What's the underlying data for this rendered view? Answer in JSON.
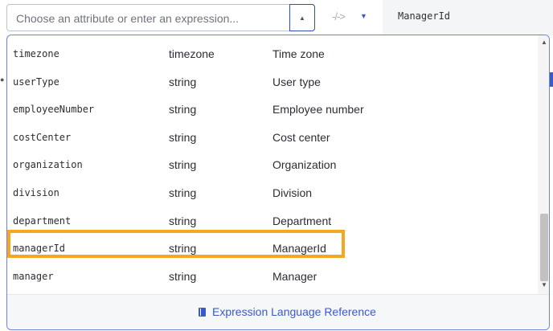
{
  "search": {
    "placeholder": "Choose an attribute or enter an expression...",
    "toggle_icon": "▲"
  },
  "toolbar": {
    "arrow_icon": "-/->",
    "mode_caret": "▼"
  },
  "target": {
    "name": "ManagerId"
  },
  "list": {
    "rows": [
      {
        "name": "timezone",
        "type": "timezone",
        "label": "Time zone"
      },
      {
        "name": "userType",
        "type": "string",
        "label": "User type"
      },
      {
        "name": "employeeNumber",
        "type": "string",
        "label": "Employee number"
      },
      {
        "name": "costCenter",
        "type": "string",
        "label": "Cost center"
      },
      {
        "name": "organization",
        "type": "string",
        "label": "Organization"
      },
      {
        "name": "division",
        "type": "string",
        "label": "Division"
      },
      {
        "name": "department",
        "type": "string",
        "label": "Department"
      },
      {
        "name": "managerId",
        "type": "string",
        "label": "ManagerId"
      },
      {
        "name": "manager",
        "type": "string",
        "label": "Manager"
      }
    ],
    "highlighted_index": 7
  },
  "scrollbar": {
    "up_icon": "▲",
    "down_icon": "▼"
  },
  "footer": {
    "link_label": "Expression Language Reference"
  },
  "colors": {
    "accent": "#3a5bc7",
    "highlight": "#f5a623"
  }
}
